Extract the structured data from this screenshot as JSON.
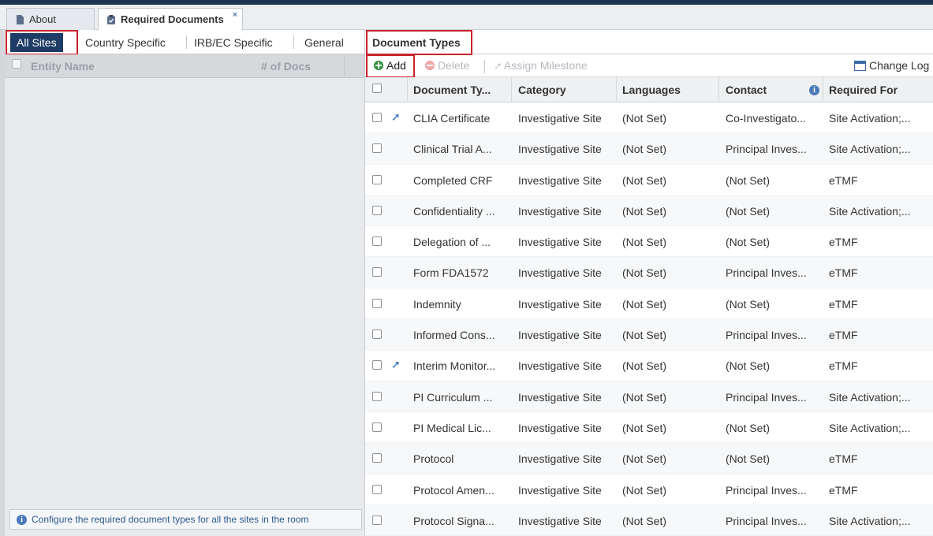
{
  "tabs": [
    {
      "label": "About",
      "icon": "document-icon"
    },
    {
      "label": "Required Documents",
      "icon": "clipboard-icon",
      "close": "×"
    }
  ],
  "left": {
    "subtabs": [
      "All Sites",
      "Country Specific",
      "IRB/EC Specific",
      "General"
    ],
    "columns": {
      "name": "Entity Name",
      "docs": "# of Docs"
    },
    "footer": "Configure the required document types for all the sites in the room"
  },
  "right": {
    "title": "Document Types",
    "toolbar": {
      "add": "Add",
      "delete": "Delete",
      "assign": "Assign Milestone",
      "change_log": "Change Log"
    },
    "columns": [
      "Document Ty...",
      "Category",
      "Languages",
      "Contact",
      "Required For"
    ],
    "rows": [
      {
        "doc": "CLIA Certificate",
        "category": "Investigative Site",
        "languages": "(Not Set)",
        "contact": "Co-Investigato...",
        "required": "Site Activation;...",
        "milestone": true
      },
      {
        "doc": "Clinical Trial A...",
        "category": "Investigative Site",
        "languages": "(Not Set)",
        "contact": "Principal Inves...",
        "required": "Site Activation;...",
        "milestone": false
      },
      {
        "doc": "Completed CRF",
        "category": "Investigative Site",
        "languages": "(Not Set)",
        "contact": "(Not Set)",
        "required": "eTMF",
        "milestone": false
      },
      {
        "doc": "Confidentiality ...",
        "category": "Investigative Site",
        "languages": "(Not Set)",
        "contact": "(Not Set)",
        "required": "Site Activation;...",
        "milestone": false
      },
      {
        "doc": "Delegation of ...",
        "category": "Investigative Site",
        "languages": "(Not Set)",
        "contact": "(Not Set)",
        "required": "eTMF",
        "milestone": false
      },
      {
        "doc": "Form FDA1572",
        "category": "Investigative Site",
        "languages": "(Not Set)",
        "contact": "Principal Inves...",
        "required": "eTMF",
        "milestone": false
      },
      {
        "doc": "Indemnity",
        "category": "Investigative Site",
        "languages": "(Not Set)",
        "contact": "(Not Set)",
        "required": "eTMF",
        "milestone": false
      },
      {
        "doc": "Informed Cons...",
        "category": "Investigative Site",
        "languages": "(Not Set)",
        "contact": "Principal Inves...",
        "required": "eTMF",
        "milestone": false
      },
      {
        "doc": "Interim Monitor...",
        "category": "Investigative Site",
        "languages": "(Not Set)",
        "contact": "(Not Set)",
        "required": "eTMF",
        "milestone": true
      },
      {
        "doc": "PI Curriculum ...",
        "category": "Investigative Site",
        "languages": "(Not Set)",
        "contact": "Principal Inves...",
        "required": "Site Activation;...",
        "milestone": false
      },
      {
        "doc": "PI Medical Lic...",
        "category": "Investigative Site",
        "languages": "(Not Set)",
        "contact": "(Not Set)",
        "required": "Site Activation;...",
        "milestone": false
      },
      {
        "doc": "Protocol",
        "category": "Investigative Site",
        "languages": "(Not Set)",
        "contact": "(Not Set)",
        "required": "eTMF",
        "milestone": false
      },
      {
        "doc": "Protocol Amen...",
        "category": "Investigative Site",
        "languages": "(Not Set)",
        "contact": "Principal Inves...",
        "required": "eTMF",
        "milestone": false
      },
      {
        "doc": "Protocol Signa...",
        "category": "Investigative Site",
        "languages": "(Not Set)",
        "contact": "Principal Inves...",
        "required": "Site Activation;...",
        "milestone": false
      }
    ]
  },
  "colors": {
    "accent": "#1d3c66",
    "highlight": "#c8232c",
    "add": "#2f8f3b"
  }
}
